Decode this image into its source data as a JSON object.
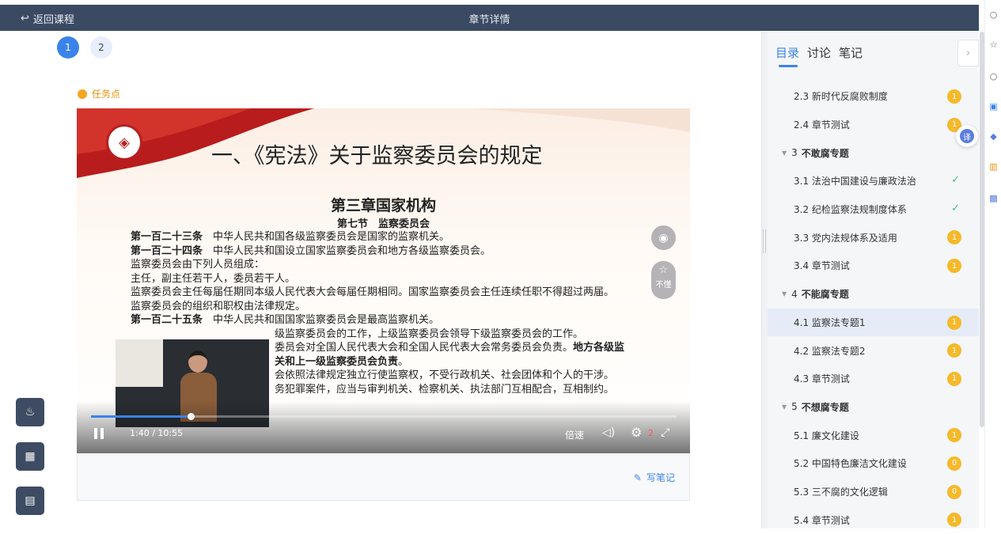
{
  "topbar": {
    "back_label": "返回课程",
    "title": "章节详情"
  },
  "pager": [
    "1",
    "2"
  ],
  "task_point": "任务点",
  "slide": {
    "title": "一、《宪法》关于监察委员会的规定",
    "chapter": "第三章国家机构",
    "section": "第七节　监察委员会",
    "lines": [
      {
        "bold": "第一百二十三条",
        "text": "　中华人民共和国各级监察委员会是国家的监察机关。"
      },
      {
        "bold": "第一百二十四条",
        "text": "　中华人民共和国设立国家监察委员会和地方各级监察委员会。"
      },
      {
        "bold": "",
        "text": "监察委员会由下列人员组成："
      },
      {
        "bold": "",
        "text": "主任，副主任若干人，委员若干人。"
      },
      {
        "bold": "",
        "text": "监察委员会主任每届任期同本级人民代表大会每届任期相同。国家监察委员会主任连续任职不得超过两届。"
      },
      {
        "bold": "",
        "text": "监察委员会的组织和职权由法律规定。"
      },
      {
        "bold": "第一百二十五条",
        "text": "　中华人民共和国国家监察委员会是最高监察机关。"
      },
      {
        "bold": "",
        "text": "　　　　　　　　　　　　　　级监察委员会的工作，上级监察委员会领导下级监察委员会的工作。"
      },
      {
        "bold": "",
        "text": "　　　　　　　　　　　　　　委员会对全国人民代表大会和全国人民代表大会常务委员会负责。",
        "tail_bold": "地方各级监"
      },
      {
        "bold": "",
        "text": "　　　　　　　　　　　　　　",
        "tail_bold": "关和上一级监察委员会负责",
        "tail": "。"
      },
      {
        "bold": "",
        "text": "　　　　　　　　　　　　　　会依照法律规定独立行使监察权，不受行政机关、社会团体和个人的干涉。"
      },
      {
        "bold": "",
        "text": "　　　　　　　　　　　　　　务犯罪案件，应当与审判机关、检察机关、执法部门互相配合，互相制约。"
      }
    ],
    "budong_label": "不懂"
  },
  "player": {
    "time": "1:40 / 10:55",
    "progress": 0.17,
    "speed_label": "倍速",
    "settings_badge": "2"
  },
  "write_note_label": "写笔记",
  "panel": {
    "tabs": [
      "目录",
      "讨论",
      "笔记"
    ],
    "items": [
      {
        "type": "item",
        "label": "2.3 新时代反腐败制度",
        "badge": "1"
      },
      {
        "type": "item",
        "label": "2.4 章节测试",
        "badge": "1"
      },
      {
        "type": "section",
        "num": "3",
        "label": "不敢腐专题"
      },
      {
        "type": "item",
        "label": "3.1 法治中国建设与廉政法治",
        "done": true
      },
      {
        "type": "item",
        "label": "3.2 纪检监察法规制度体系",
        "done": true
      },
      {
        "type": "item",
        "label": "3.3 党内法规体系及适用",
        "badge": "1"
      },
      {
        "type": "item",
        "label": "3.4 章节测试",
        "badge": "1"
      },
      {
        "type": "section",
        "num": "4",
        "label": "不能腐专题"
      },
      {
        "type": "item",
        "label": "4.1 监察法专题1",
        "badge": "1",
        "current": true
      },
      {
        "type": "item",
        "label": "4.2 监察法专题2",
        "badge": "1"
      },
      {
        "type": "item",
        "label": "4.3 章节测试",
        "badge": "1"
      },
      {
        "type": "section",
        "num": "5",
        "label": "不想腐专题"
      },
      {
        "type": "item",
        "label": "5.1 廉文化建设",
        "badge": "1"
      },
      {
        "type": "item",
        "label": "5.2 中国特色廉洁文化建设",
        "badge": "0"
      },
      {
        "type": "item",
        "label": "5.3 三不腐的文化逻辑",
        "badge": "0"
      },
      {
        "type": "item",
        "label": "5.4 章节测试",
        "badge": "1"
      }
    ]
  },
  "translate_label": "译",
  "colors": {
    "topbar": "#3a4a63",
    "accent": "#3a83e8",
    "badge": "#f5b92a",
    "done": "#3cbf7a"
  }
}
